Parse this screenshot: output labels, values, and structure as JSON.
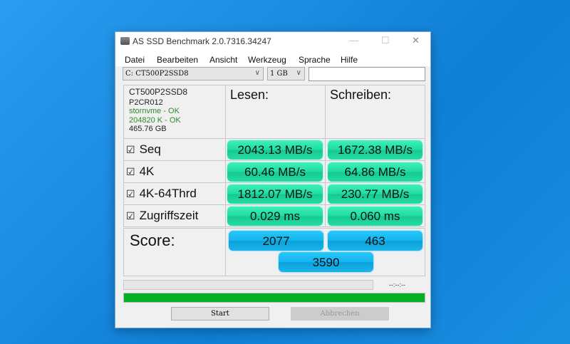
{
  "window": {
    "title": "AS SSD Benchmark 2.0.7316.34247",
    "minimize": "—",
    "maximize": "☐",
    "close": "✕"
  },
  "menu": [
    "Datei",
    "Bearbeiten",
    "Ansicht",
    "Werkzeug",
    "Sprache",
    "Hilfe"
  ],
  "drive_select": "C: CT500P2SSD8",
  "size_select": "1 GB",
  "text_field": "",
  "info": {
    "model": "CT500P2SSD8",
    "firmware": "P2CR012",
    "driver": "stornvme - OK",
    "alignment": "204820 K - OK",
    "capacity": "465.76 GB"
  },
  "headers": {
    "read": "Lesen:",
    "write": "Schreiben:"
  },
  "rows": [
    {
      "label": "Seq",
      "checked": true,
      "read": "2043.13 MB/s",
      "write": "1672.38 MB/s"
    },
    {
      "label": "4K",
      "checked": true,
      "read": "60.46 MB/s",
      "write": "64.86 MB/s"
    },
    {
      "label": "4K-64Thrd",
      "checked": true,
      "read": "1812.07 MB/s",
      "write": "230.77 MB/s"
    },
    {
      "label": "Zugriffszeit",
      "checked": true,
      "read": "0.029 ms",
      "write": "0.060 ms"
    }
  ],
  "score": {
    "label": "Score:",
    "read": "2077",
    "write": "463",
    "total": "3590"
  },
  "time": "--:--:--",
  "progress_top": 0,
  "progress_bottom": 100,
  "buttons": {
    "start": "Start",
    "cancel": "Abbrechen"
  },
  "checkbox": "☑"
}
